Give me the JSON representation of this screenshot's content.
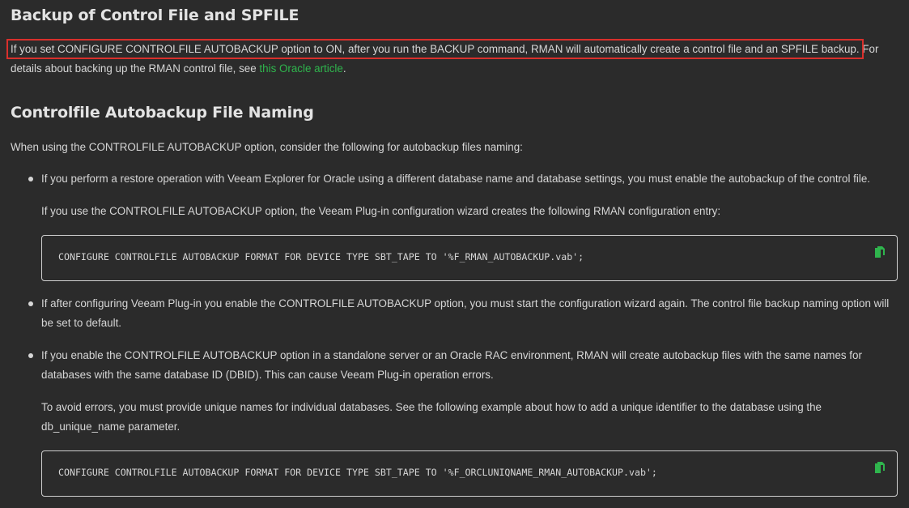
{
  "section1": {
    "title": "Backup of Control File and SPFILE",
    "highlighted_text": "If you set CONFIGURE CONTROLFILE AUTOBACKUP option to ON, after you run the BACKUP command, RMAN will automatically create a control file and an SPFILE backup.",
    "rest_text": " For details about backing up the RMAN control file, see ",
    "link_text": "this Oracle article",
    "end_text": "."
  },
  "section2": {
    "title": "Controlfile Autobackup File Naming",
    "intro": "When using the CONTROLFILE AUTOBACKUP option, consider the following for autobackup files naming:",
    "items": [
      {
        "text": "If you perform a restore operation with Veeam Explorer for Oracle using a different database name and database settings, you must enable the autobackup of the control file.",
        "sub_text": "If you use the CONTROLFILE AUTOBACKUP option, the Veeam Plug-in configuration wizard creates the following RMAN configuration entry:",
        "code": "CONFIGURE CONTROLFILE AUTOBACKUP FORMAT FOR DEVICE TYPE SBT_TAPE TO '%F_RMAN_AUTOBACKUP.vab';"
      },
      {
        "text": "If after configuring Veeam Plug-in you enable the CONTROLFILE AUTOBACKUP option, you must start the configuration wizard again. The control file backup naming option will be set to default."
      },
      {
        "text": "If you enable the CONTROLFILE AUTOBACKUP option in a standalone server or an Oracle RAC environment, RMAN will create autobackup files with the same names for databases with the same database ID (DBID). This can cause Veeam Plug-in operation errors.",
        "sub_text": "To avoid errors, you must provide unique names for individual databases. See the following example about how to add a unique identifier to the database using the db_unique_name parameter.",
        "code": "CONFIGURE CONTROLFILE AUTOBACKUP FORMAT FOR DEVICE TYPE SBT_TAPE TO '%F_ORCLUNIQNAME_RMAN_AUTOBACKUP.vab';"
      }
    ]
  },
  "icons": {
    "copy": "copy-icon"
  },
  "colors": {
    "background": "#2b2b2b",
    "text": "#d6d6d6",
    "link": "#2fb54d",
    "highlight_border": "#d9302c",
    "copy_icon": "#2fb54d"
  }
}
